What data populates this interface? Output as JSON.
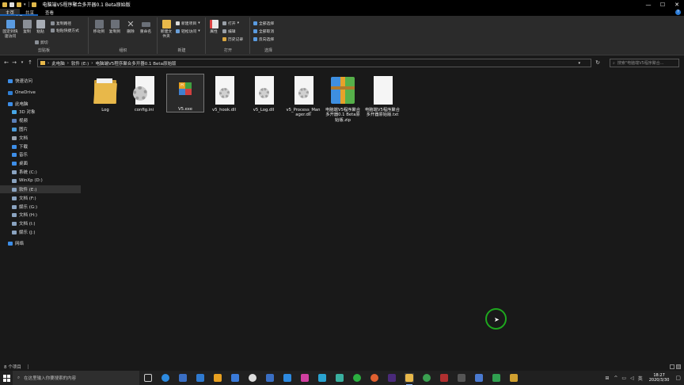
{
  "window": {
    "title": "电脑端V5程序聚合多开器0.1 Beta原始版",
    "controls": {
      "minimize": "—",
      "maximize": "☐",
      "close": "✕"
    }
  },
  "ribbon_tabs": [
    {
      "label": "文件"
    },
    {
      "label": "主页"
    },
    {
      "label": "共享"
    },
    {
      "label": "查看"
    }
  ],
  "ribbon": {
    "clipboard": {
      "pin_label": "固定到快速访问",
      "copy_label": "复制",
      "paste_label": "粘贴",
      "copy_path_label": "复制路径",
      "paste_shortcut_label": "粘贴快捷方式",
      "cut_label": "剪切",
      "group_label": "剪贴板"
    },
    "organize": {
      "move_to_label": "移动到",
      "copy_to_label": "复制到",
      "delete_label": "删除",
      "rename_label": "重命名",
      "group_label": "组织"
    },
    "new": {
      "new_folder_label": "新建文件夹",
      "new_item_label": "新建项目",
      "easy_access_label": "轻松访问",
      "group_label": "新建"
    },
    "open": {
      "properties_label": "属性",
      "open_label": "打开",
      "edit_label": "编辑",
      "history_label": "历史记录",
      "group_label": "打开"
    },
    "select": {
      "select_all_label": "全部选择",
      "select_none_label": "全部取消",
      "invert_label": "反向选择",
      "group_label": "选择"
    }
  },
  "address": {
    "path": [
      {
        "label": "此电脑"
      },
      {
        "label": "软件 (E:)"
      },
      {
        "label": "电脑端V5程序聚合多开器0.1 Beta原始版"
      }
    ],
    "search_placeholder": "搜索\"电脑端V5程序聚合...",
    "separator": "›"
  },
  "sidebar": {
    "items": [
      {
        "label": "快速访问",
        "color": "#3d8ee8"
      },
      {
        "label": "OneDrive",
        "color": "#2f7fd6"
      },
      {
        "label": "此电脑",
        "color": "#3d8ee8"
      },
      {
        "label": "3D 对象",
        "color": "#47a6e6"
      },
      {
        "label": "视频",
        "color": "#5a7fb8"
      },
      {
        "label": "图片",
        "color": "#4b9ad8"
      },
      {
        "label": "文档",
        "color": "#9aa4b0"
      },
      {
        "label": "下载",
        "color": "#3d8ee8"
      },
      {
        "label": "音乐",
        "color": "#3d8ee8"
      },
      {
        "label": "桌面",
        "color": "#3d8ee8"
      },
      {
        "label": "系统 (C:)",
        "color": "#8aa3c0"
      },
      {
        "label": "WinXp (D:)",
        "color": "#8aa3c0"
      },
      {
        "label": "软件 (E:)",
        "color": "#8aa3c0"
      },
      {
        "label": "文档 (F:)",
        "color": "#8aa3c0"
      },
      {
        "label": "娱乐 (G:)",
        "color": "#8aa3c0"
      },
      {
        "label": "文档 (H:)",
        "color": "#8aa3c0"
      },
      {
        "label": "文档 (I:)",
        "color": "#8aa3c0"
      },
      {
        "label": "娱乐 (J:)",
        "color": "#8aa3c0"
      },
      {
        "label": "网络",
        "color": "#3d8ee8"
      }
    ]
  },
  "files": [
    {
      "name": "Log",
      "icon": "folder-icon"
    },
    {
      "name": "config.ini",
      "icon": "settings-file-icon"
    },
    {
      "name": "V5.exe",
      "icon": "exe-icon"
    },
    {
      "name": "v5_hook.dll",
      "icon": "dll-icon"
    },
    {
      "name": "v5_Log.dll",
      "icon": "dll-icon"
    },
    {
      "name": "v5_Process_Manager.dll",
      "icon": "dll-icon"
    },
    {
      "name": "电脑端V5程序聚合多开器0.1 Beta原始版.zip",
      "icon": "zip-icon"
    },
    {
      "name": "电脑端V5程序聚合多开器原始版.txt",
      "icon": "txt-icon"
    }
  ],
  "status": {
    "count": "8 个项目"
  },
  "taskbar": {
    "search_placeholder": "在这里输入你要搜索的内容",
    "time": "18:27",
    "date": "2020/3/30",
    "ime": "英",
    "notification": "▢"
  },
  "colors": {
    "accent": "#1a62b8",
    "cursor_ring": "#1ea81e",
    "folder": "#e8b84a"
  }
}
